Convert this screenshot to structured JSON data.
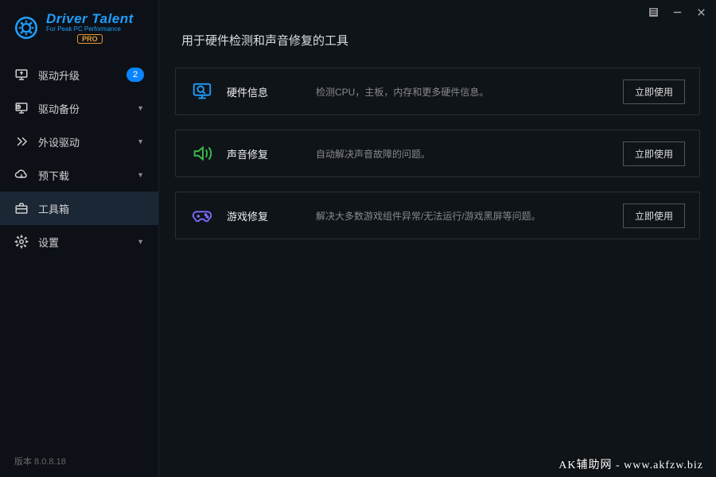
{
  "brand": {
    "title": "Driver Talent",
    "subtitle": "For Peak PC Performance",
    "badge": "PRO"
  },
  "sidebar": {
    "items": [
      {
        "label": "驱动升级",
        "badge": "2"
      },
      {
        "label": "驱动备份"
      },
      {
        "label": "外设驱动"
      },
      {
        "label": "预下载"
      },
      {
        "label": "工具箱"
      },
      {
        "label": "设置"
      }
    ]
  },
  "version": "版本 8.0.8.18",
  "page": {
    "title": "用于硬件检测和声音修复的工具"
  },
  "tools": [
    {
      "name": "硬件信息",
      "desc": "检测CPU，主板，内存和更多硬件信息。",
      "action": "立即使用"
    },
    {
      "name": "声音修复",
      "desc": "自动解决声音故障的问题。",
      "action": "立即使用"
    },
    {
      "name": "游戏修复",
      "desc": "解决大多数游戏组件异常/无法运行/游戏黑屏等问题。",
      "action": "立即使用"
    }
  ],
  "watermark": "AK辅助网 - www.akfzw.biz",
  "colors": {
    "accent": "#0a84ff",
    "green": "#3bc14a",
    "purple": "#7b6bff"
  }
}
